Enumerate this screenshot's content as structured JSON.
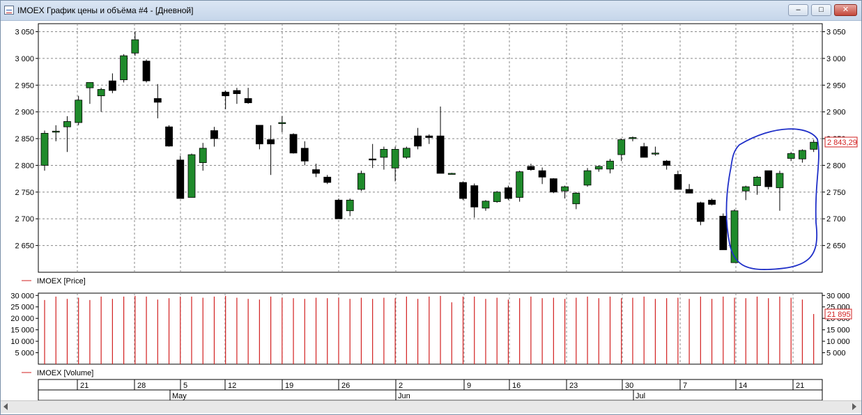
{
  "window": {
    "title": "IMOEX График цены и объёма #4 - [Дневной]",
    "buttons": [
      "minimize",
      "maximize",
      "close"
    ]
  },
  "price_panel": {
    "legend": "IMOEX [Price]",
    "y_ticks": [
      "3 050",
      "3 000",
      "2 950",
      "2 900",
      "2 850",
      "2 800",
      "2 750",
      "2 700",
      "2 650"
    ],
    "last_value_label": "2 843,29",
    "up_color": "#1f8a2b",
    "down_color": "#000000",
    "annotation_color": "#1f2fc8"
  },
  "volume_panel": {
    "legend": "IMOEX [Volume]",
    "y_ticks": [
      "30 000",
      "25 000",
      "20 000",
      "15 000",
      "10 000",
      "5 000"
    ],
    "last_value_label": "21 895",
    "bar_color": "#d21f1f"
  },
  "x_axis": {
    "days": [
      "21",
      "28",
      "5",
      "12",
      "19",
      "26",
      "2",
      "9",
      "16",
      "23",
      "30",
      "7",
      "14",
      "21"
    ],
    "months": [
      "May",
      "Jun",
      "Jul"
    ]
  },
  "chart_data": {
    "type": "candlestick",
    "series": [
      {
        "name": "IMOEX [Price]",
        "candles": [
          {
            "o": 2800,
            "h": 2865,
            "l": 2790,
            "c": 2860
          },
          {
            "o": 2862,
            "h": 2875,
            "l": 2845,
            "c": 2864
          },
          {
            "o": 2872,
            "h": 2892,
            "l": 2825,
            "c": 2882
          },
          {
            "o": 2880,
            "h": 2930,
            "l": 2875,
            "c": 2922
          },
          {
            "o": 2945,
            "h": 2955,
            "l": 2915,
            "c": 2955
          },
          {
            "o": 2930,
            "h": 2945,
            "l": 2900,
            "c": 2942
          },
          {
            "o": 2958,
            "h": 2972,
            "l": 2935,
            "c": 2940
          },
          {
            "o": 2960,
            "h": 3008,
            "l": 2955,
            "c": 3005
          },
          {
            "o": 3010,
            "h": 3050,
            "l": 3005,
            "c": 3035
          },
          {
            "o": 2995,
            "h": 2998,
            "l": 2955,
            "c": 2958
          },
          {
            "o": 2925,
            "h": 2952,
            "l": 2888,
            "c": 2918
          },
          {
            "o": 2872,
            "h": 2875,
            "l": 2835,
            "c": 2836
          },
          {
            "o": 2810,
            "h": 2818,
            "l": 2738,
            "c": 2738
          },
          {
            "o": 2740,
            "h": 2822,
            "l": 2740,
            "c": 2820
          },
          {
            "o": 2805,
            "h": 2842,
            "l": 2790,
            "c": 2832
          },
          {
            "o": 2865,
            "h": 2872,
            "l": 2835,
            "c": 2850
          },
          {
            "o": 2937,
            "h": 2940,
            "l": 2905,
            "c": 2930
          },
          {
            "o": 2940,
            "h": 2945,
            "l": 2915,
            "c": 2934
          },
          {
            "o": 2925,
            "h": 2945,
            "l": 2915,
            "c": 2917
          },
          {
            "o": 2875,
            "h": 2875,
            "l": 2830,
            "c": 2840
          },
          {
            "o": 2848,
            "h": 2875,
            "l": 2782,
            "c": 2840
          },
          {
            "o": 2880,
            "h": 2892,
            "l": 2862,
            "c": 2880
          },
          {
            "o": 2858,
            "h": 2860,
            "l": 2822,
            "c": 2823
          },
          {
            "o": 2832,
            "h": 2845,
            "l": 2800,
            "c": 2808
          },
          {
            "o": 2792,
            "h": 2803,
            "l": 2778,
            "c": 2785
          },
          {
            "o": 2778,
            "h": 2782,
            "l": 2765,
            "c": 2768
          },
          {
            "o": 2735,
            "h": 2738,
            "l": 2700,
            "c": 2700
          },
          {
            "o": 2715,
            "h": 2738,
            "l": 2705,
            "c": 2735
          },
          {
            "o": 2755,
            "h": 2790,
            "l": 2752,
            "c": 2785
          },
          {
            "o": 2812,
            "h": 2840,
            "l": 2795,
            "c": 2810
          },
          {
            "o": 2815,
            "h": 2835,
            "l": 2792,
            "c": 2830
          },
          {
            "o": 2795,
            "h": 2835,
            "l": 2770,
            "c": 2830
          },
          {
            "o": 2815,
            "h": 2835,
            "l": 2812,
            "c": 2832
          },
          {
            "o": 2855,
            "h": 2870,
            "l": 2830,
            "c": 2836
          },
          {
            "o": 2855,
            "h": 2858,
            "l": 2840,
            "c": 2852
          },
          {
            "o": 2855,
            "h": 2910,
            "l": 2785,
            "c": 2785
          },
          {
            "o": 2785,
            "h": 2786,
            "l": 2784,
            "c": 2785
          },
          {
            "o": 2768,
            "h": 2770,
            "l": 2735,
            "c": 2738
          },
          {
            "o": 2762,
            "h": 2766,
            "l": 2702,
            "c": 2722
          },
          {
            "o": 2720,
            "h": 2735,
            "l": 2715,
            "c": 2733
          },
          {
            "o": 2732,
            "h": 2752,
            "l": 2730,
            "c": 2750
          },
          {
            "o": 2758,
            "h": 2762,
            "l": 2735,
            "c": 2738
          },
          {
            "o": 2740,
            "h": 2790,
            "l": 2732,
            "c": 2788
          },
          {
            "o": 2798,
            "h": 2803,
            "l": 2790,
            "c": 2792
          },
          {
            "o": 2790,
            "h": 2796,
            "l": 2765,
            "c": 2778
          },
          {
            "o": 2775,
            "h": 2776,
            "l": 2748,
            "c": 2750
          },
          {
            "o": 2752,
            "h": 2762,
            "l": 2738,
            "c": 2760
          },
          {
            "o": 2728,
            "h": 2750,
            "l": 2718,
            "c": 2748
          },
          {
            "o": 2763,
            "h": 2795,
            "l": 2760,
            "c": 2790
          },
          {
            "o": 2793,
            "h": 2800,
            "l": 2788,
            "c": 2798
          },
          {
            "o": 2793,
            "h": 2812,
            "l": 2785,
            "c": 2808
          },
          {
            "o": 2820,
            "h": 2850,
            "l": 2808,
            "c": 2848
          },
          {
            "o": 2850,
            "h": 2854,
            "l": 2845,
            "c": 2852
          },
          {
            "o": 2835,
            "h": 2842,
            "l": 2815,
            "c": 2815
          },
          {
            "o": 2822,
            "h": 2835,
            "l": 2818,
            "c": 2823
          },
          {
            "o": 2808,
            "h": 2810,
            "l": 2792,
            "c": 2800
          },
          {
            "o": 2783,
            "h": 2790,
            "l": 2755,
            "c": 2755
          },
          {
            "o": 2755,
            "h": 2765,
            "l": 2748,
            "c": 2748
          },
          {
            "o": 2730,
            "h": 2732,
            "l": 2688,
            "c": 2695
          },
          {
            "o": 2735,
            "h": 2738,
            "l": 2725,
            "c": 2727
          },
          {
            "o": 2705,
            "h": 2710,
            "l": 2642,
            "c": 2642
          },
          {
            "o": 2618,
            "h": 2718,
            "l": 2618,
            "c": 2715
          },
          {
            "o": 2752,
            "h": 2762,
            "l": 2735,
            "c": 2760
          },
          {
            "o": 2762,
            "h": 2780,
            "l": 2745,
            "c": 2778
          },
          {
            "o": 2790,
            "h": 2790,
            "l": 2755,
            "c": 2760
          },
          {
            "o": 2758,
            "h": 2790,
            "l": 2715,
            "c": 2785
          },
          {
            "o": 2813,
            "h": 2825,
            "l": 2808,
            "c": 2822
          },
          {
            "o": 2812,
            "h": 2830,
            "l": 2805,
            "c": 2828
          },
          {
            "o": 2830,
            "h": 2848,
            "l": 2825,
            "c": 2843.29
          }
        ]
      },
      {
        "name": "IMOEX [Volume]",
        "values": [
          28000,
          29500,
          28500,
          29000,
          28000,
          29500,
          28500,
          29500,
          29800,
          29500,
          28200,
          28800,
          29500,
          29500,
          29000,
          29500,
          29800,
          29000,
          28500,
          28200,
          29500,
          29000,
          28800,
          28500,
          29000,
          28800,
          29000,
          28500,
          29000,
          28500,
          29000,
          28800,
          29500,
          28500,
          29500,
          29800,
          27000,
          29500,
          29500,
          28500,
          29000,
          28200,
          28800,
          29500,
          28800,
          29000,
          28500,
          29000,
          29500,
          28800,
          29500,
          28800,
          29000,
          29500,
          28500,
          28800,
          29000,
          28500,
          29500,
          28500,
          29500,
          29000,
          28800,
          29500,
          28800,
          29500,
          29000,
          28200,
          21895
        ]
      }
    ],
    "ylim_price": [
      2600,
      3065
    ],
    "ylim_volume": [
      0,
      31000
    ],
    "grid": true
  }
}
